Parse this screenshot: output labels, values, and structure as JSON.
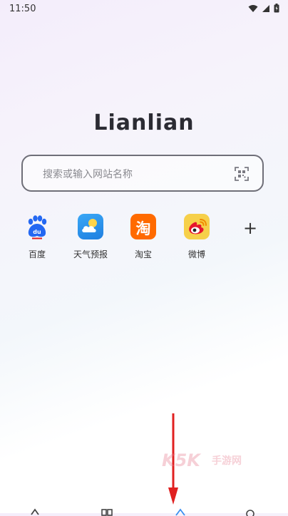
{
  "status_bar": {
    "time": "11:50"
  },
  "brand": {
    "title": "Lianlian"
  },
  "search": {
    "placeholder": "搜索或输入网站名称"
  },
  "shortcuts": [
    {
      "label": "百度",
      "icon": "baidu-icon",
      "color": "#2468f2"
    },
    {
      "label": "天气预报",
      "icon": "weather-icon",
      "color": "#2f9cf4"
    },
    {
      "label": "淘宝",
      "icon": "taobao-icon",
      "color": "#ff6a00",
      "glyph": "淘"
    },
    {
      "label": "微博",
      "icon": "weibo-icon",
      "color": "#f6d04a"
    }
  ],
  "add_shortcut": {
    "icon": "plus-icon",
    "glyph": "+"
  },
  "watermark": {
    "text_a": "K5K",
    "text_b": "手游网"
  },
  "colors": {
    "accent": "#e02020",
    "text": "#2b2b33"
  }
}
